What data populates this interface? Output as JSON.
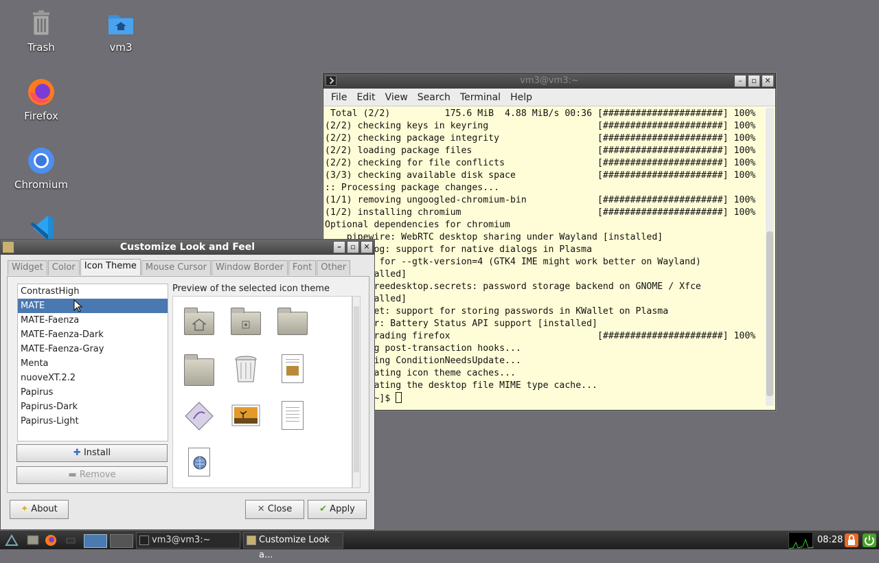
{
  "desktop": {
    "icons": [
      {
        "label": "Trash"
      },
      {
        "label": "vm3"
      },
      {
        "label": "Firefox"
      },
      {
        "label": "Chromium"
      }
    ]
  },
  "terminal": {
    "title": "vm3@vm3:~",
    "menu": [
      "File",
      "Edit",
      "View",
      "Search",
      "Terminal",
      "Help"
    ],
    "lines": [
      " Total (2/2)          175.6 MiB  4.88 MiB/s 00:36 [######################] 100%",
      "(2/2) checking keys in keyring                    [######################] 100%",
      "(2/2) checking package integrity                  [######################] 100%",
      "(2/2) loading package files                       [######################] 100%",
      "(2/2) checking for file conflicts                 [######################] 100%",
      "(3/3) checking available disk space               [######################] 100%",
      ":: Processing package changes...",
      "(1/1) removing ungoogled-chromium-bin             [######################] 100%",
      "(1/2) installing chromium                         [######################] 100%",
      "Optional dependencies for chromium",
      "    pipewire: WebRTC desktop sharing under Wayland [installed]",
      "    kdialog: support for native dialogs in Plasma",
      "    gtk4: for --gtk-version=4 (GTK4 IME might work better on Wayland)",
      "    [installed]",
      "    org.freedesktop.secrets: password storage backend on GNOME / Xfce",
      "    [installed]",
      "    kwallet: support for storing passwords in KWallet on Plasma",
      "    upower: Battery Status API support [installed]",
      "(2/2) upgrading firefox                           [######################] 100%",
      ":: Running post-transaction hooks...",
      "(1/3) Arming ConditionNeedsUpdate...",
      "(2/3) Updating icon theme caches...",
      "(3/3) Updating the desktop file MIME type cache...",
      "[vm3@vm3 ~]$ "
    ]
  },
  "dialog": {
    "title": "Customize Look and Feel",
    "tabs": [
      "Widget",
      "Color",
      "Icon Theme",
      "Mouse Cursor",
      "Window Border",
      "Font",
      "Other"
    ],
    "active_tab": "Icon Theme",
    "themes": [
      "ContrastHigh",
      "MATE",
      "MATE-Faenza",
      "MATE-Faenza-Dark",
      "MATE-Faenza-Gray",
      "Menta",
      "nuoveXT.2.2",
      "Papirus",
      "Papirus-Dark",
      "Papirus-Light"
    ],
    "selected_theme": "MATE",
    "install_label": "Install",
    "remove_label": "Remove",
    "preview_label": "Preview of the selected icon theme",
    "about_label": "About",
    "close_label": "Close",
    "apply_label": "Apply"
  },
  "taskbar": {
    "tasks": [
      {
        "label": "vm3@vm3:~"
      },
      {
        "label": "Customize Look a..."
      }
    ],
    "clock": "08:28"
  },
  "colors": {
    "desktop_bg": "#6e6e74",
    "terminal_bg": "#fffdd7",
    "selection": "#4a78b0"
  }
}
